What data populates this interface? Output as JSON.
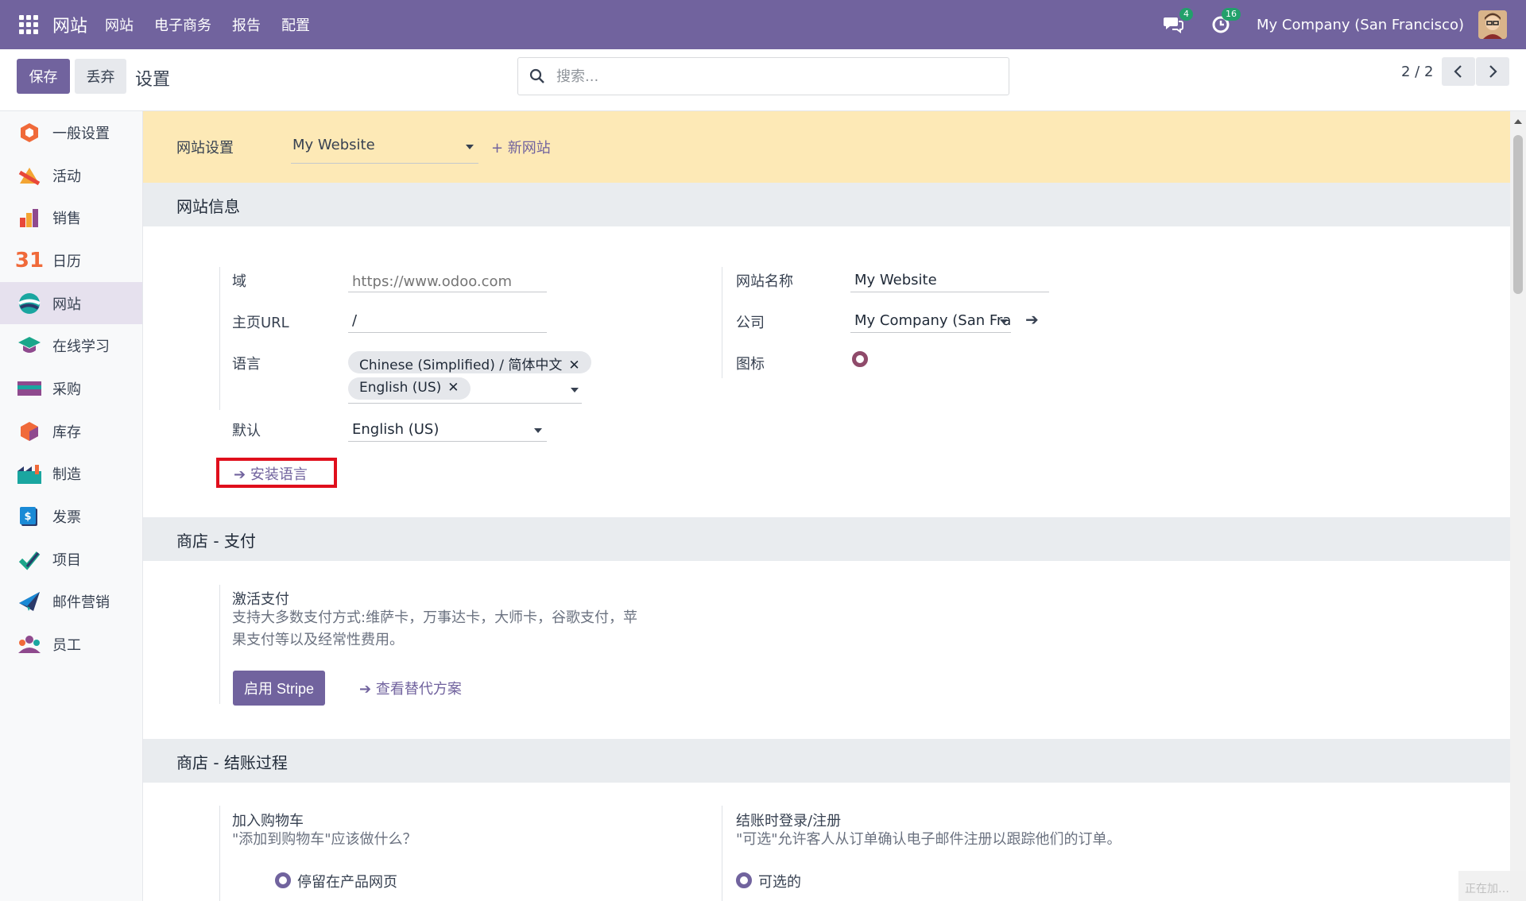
{
  "navbar": {
    "brand": "网站",
    "menu": [
      "网站",
      "电子商务",
      "报告",
      "配置"
    ],
    "messages_count": "4",
    "activities_count": "16",
    "company": "My Company (San Francisco)"
  },
  "control": {
    "save_label": "保存",
    "discard_label": "丢弃",
    "breadcrumb": "设置",
    "search_placeholder": "搜索...",
    "pager": "2 / 2"
  },
  "sidebar": {
    "items": [
      {
        "label": "一般设置",
        "icon": "general-settings-icon"
      },
      {
        "label": "活动",
        "icon": "activity-icon"
      },
      {
        "label": "销售",
        "icon": "sales-icon"
      },
      {
        "label": "日历",
        "icon": "calendar-icon"
      },
      {
        "label": "网站",
        "icon": "website-icon"
      },
      {
        "label": "在线学习",
        "icon": "elearning-icon"
      },
      {
        "label": "采购",
        "icon": "purchase-icon"
      },
      {
        "label": "库存",
        "icon": "inventory-icon"
      },
      {
        "label": "制造",
        "icon": "manufacturing-icon"
      },
      {
        "label": "发票",
        "icon": "invoice-icon"
      },
      {
        "label": "项目",
        "icon": "project-icon"
      },
      {
        "label": "邮件营销",
        "icon": "email-marketing-icon"
      },
      {
        "label": "员工",
        "icon": "employees-icon"
      }
    ]
  },
  "banner": {
    "label": "网站设置",
    "selected_website": "My Website",
    "new_site": "+ 新网站"
  },
  "website_info": {
    "heading": "网站信息",
    "domain_label": "域",
    "domain_placeholder": "https://www.odoo.com",
    "homepage_label": "主页URL",
    "homepage_value": "/",
    "languages_label": "语言",
    "languages": [
      "Chinese (Simplified) / 简体中文",
      "English (US)"
    ],
    "default_label": "默认",
    "default_value": "English (US)",
    "install_language": "安装语言",
    "site_name_label": "网站名称",
    "site_name_value": "My Website",
    "company_label": "公司",
    "company_value": "My Company (San Fra",
    "favicon_label": "图标"
  },
  "payment": {
    "heading": "商店 - 支付",
    "title": "激活支付",
    "description_line1": "支持大多数支付方式:维萨卡，万事达卡，大师卡，谷歌支付，苹",
    "description_line2": "果支付等以及经常性费用。",
    "stripe_button": "启用 Stripe",
    "alternatives_link": "查看替代方案"
  },
  "checkout": {
    "heading": "商店 - 结账过程",
    "cart_title": "加入购物车",
    "cart_desc": "\"添加到购物车\"应该做什么？",
    "cart_option": "停留在产品网页",
    "login_title": "结账时登录/注册",
    "login_desc": "\"可选\"允许客人从订单确认电子邮件注册以跟踪他们的订单。",
    "login_option": "可选的"
  },
  "status_text": "正在加…",
  "colors": {
    "brand": "#71639e",
    "banner": "#fde9b6",
    "highlight": "#e00f1c",
    "badge": "#22a06b"
  }
}
